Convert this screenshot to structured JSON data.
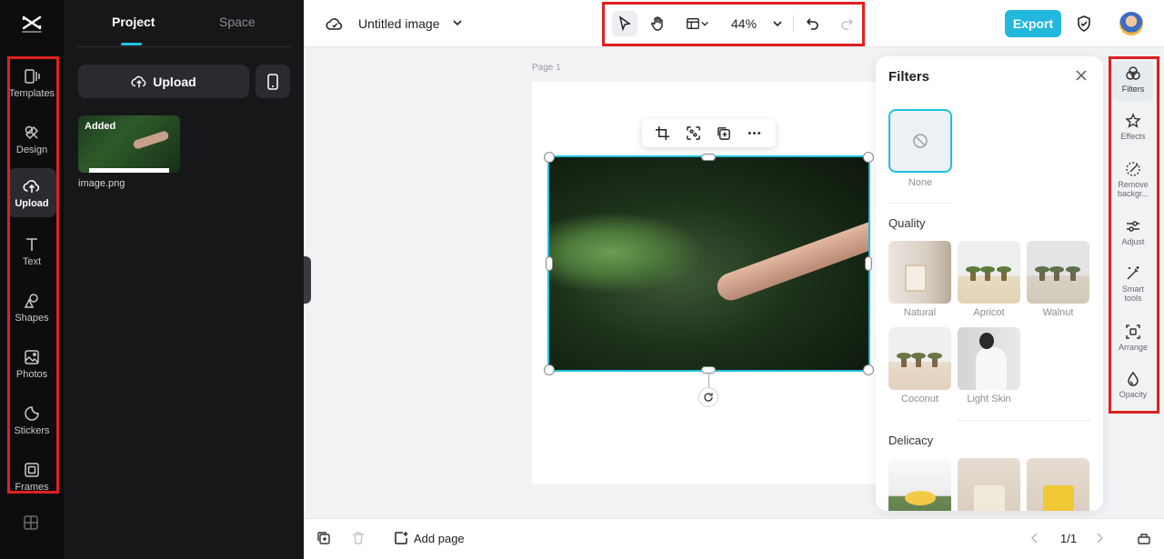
{
  "app": {
    "doc_title": "Untitled image",
    "export_label": "Export",
    "accent": "#22b8dd",
    "highlight": "#e02020"
  },
  "sidebar": {
    "items": [
      {
        "label": "Templates",
        "icon": "templates-icon"
      },
      {
        "label": "Design",
        "icon": "design-icon"
      },
      {
        "label": "Upload",
        "icon": "upload-cloud-icon",
        "active": true
      },
      {
        "label": "Text",
        "icon": "text-icon"
      },
      {
        "label": "Shapes",
        "icon": "shapes-icon"
      },
      {
        "label": "Photos",
        "icon": "photos-icon"
      },
      {
        "label": "Stickers",
        "icon": "stickers-icon"
      },
      {
        "label": "Frames",
        "icon": "frames-icon"
      }
    ]
  },
  "panel": {
    "tabs": [
      "Project",
      "Space"
    ],
    "upload_label": "Upload",
    "asset": {
      "badge": "Added",
      "name": "image.png"
    }
  },
  "toolbar": {
    "zoom": "44%"
  },
  "canvas": {
    "page_label": "Page 1"
  },
  "filters": {
    "title": "Filters",
    "none_label": "None",
    "sections": [
      {
        "title": "Quality",
        "items": [
          "Natural",
          "Apricot",
          "Walnut",
          "Coconut",
          "Light Skin"
        ]
      },
      {
        "title": "Delicacy",
        "items": []
      }
    ]
  },
  "right_rail": {
    "items": [
      {
        "label": "Filters",
        "icon": "filters-icon",
        "active": true
      },
      {
        "label": "Effects",
        "icon": "effects-icon"
      },
      {
        "label": "Remove backgr...",
        "icon": "remove-background-icon"
      },
      {
        "label": "Adjust",
        "icon": "adjust-icon"
      },
      {
        "label": "Smart tools",
        "icon": "smart-tools-icon"
      },
      {
        "label": "Arrange",
        "icon": "arrange-icon"
      },
      {
        "label": "Opacity",
        "icon": "opacity-icon"
      }
    ]
  },
  "bottom": {
    "add_page_label": "Add page",
    "pager": "1/1"
  }
}
